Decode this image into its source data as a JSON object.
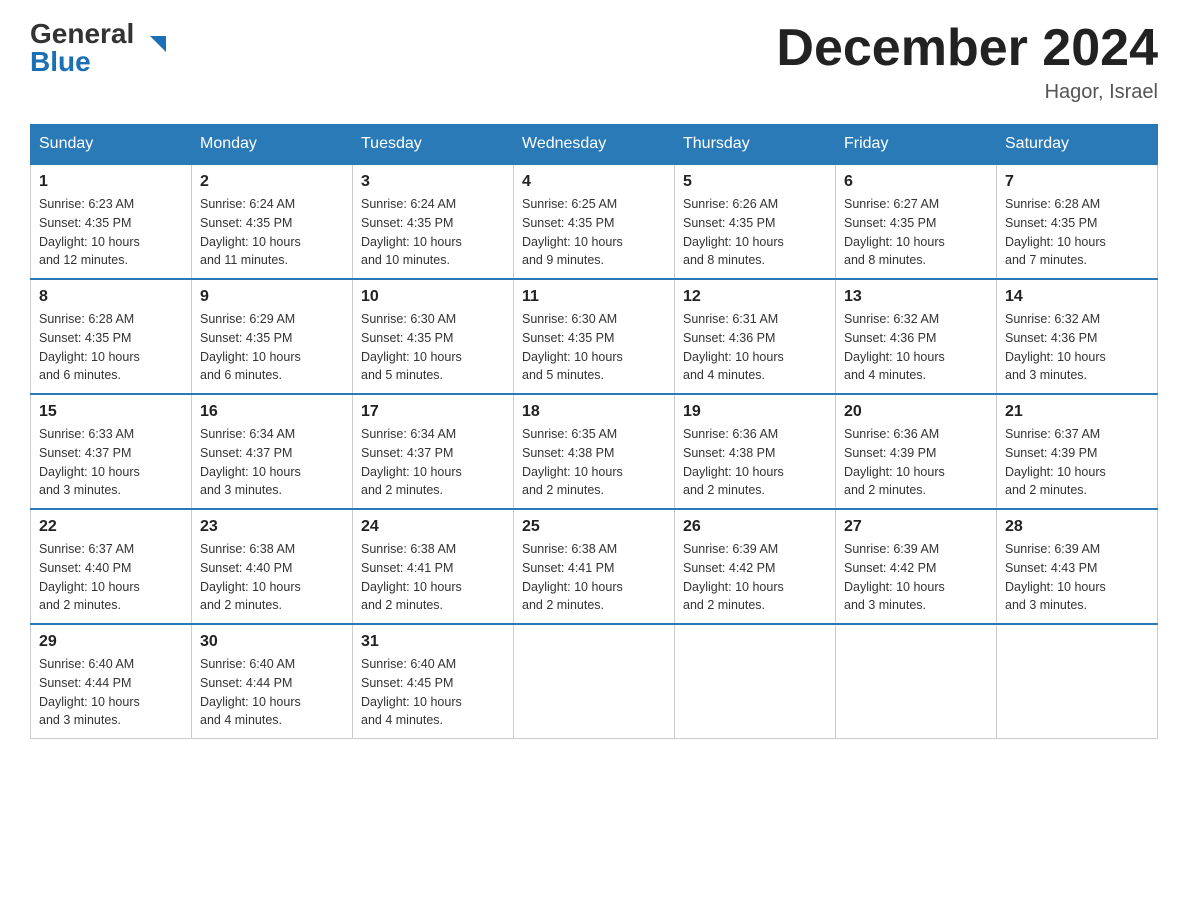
{
  "header": {
    "logo_general": "General",
    "logo_blue": "Blue",
    "month_title": "December 2024",
    "location": "Hagor, Israel"
  },
  "weekdays": [
    "Sunday",
    "Monday",
    "Tuesday",
    "Wednesday",
    "Thursday",
    "Friday",
    "Saturday"
  ],
  "weeks": [
    [
      {
        "day": "1",
        "sunrise": "6:23 AM",
        "sunset": "4:35 PM",
        "daylight": "10 hours and 12 minutes."
      },
      {
        "day": "2",
        "sunrise": "6:24 AM",
        "sunset": "4:35 PM",
        "daylight": "10 hours and 11 minutes."
      },
      {
        "day": "3",
        "sunrise": "6:24 AM",
        "sunset": "4:35 PM",
        "daylight": "10 hours and 10 minutes."
      },
      {
        "day": "4",
        "sunrise": "6:25 AM",
        "sunset": "4:35 PM",
        "daylight": "10 hours and 9 minutes."
      },
      {
        "day": "5",
        "sunrise": "6:26 AM",
        "sunset": "4:35 PM",
        "daylight": "10 hours and 8 minutes."
      },
      {
        "day": "6",
        "sunrise": "6:27 AM",
        "sunset": "4:35 PM",
        "daylight": "10 hours and 8 minutes."
      },
      {
        "day": "7",
        "sunrise": "6:28 AM",
        "sunset": "4:35 PM",
        "daylight": "10 hours and 7 minutes."
      }
    ],
    [
      {
        "day": "8",
        "sunrise": "6:28 AM",
        "sunset": "4:35 PM",
        "daylight": "10 hours and 6 minutes."
      },
      {
        "day": "9",
        "sunrise": "6:29 AM",
        "sunset": "4:35 PM",
        "daylight": "10 hours and 6 minutes."
      },
      {
        "day": "10",
        "sunrise": "6:30 AM",
        "sunset": "4:35 PM",
        "daylight": "10 hours and 5 minutes."
      },
      {
        "day": "11",
        "sunrise": "6:30 AM",
        "sunset": "4:35 PM",
        "daylight": "10 hours and 5 minutes."
      },
      {
        "day": "12",
        "sunrise": "6:31 AM",
        "sunset": "4:36 PM",
        "daylight": "10 hours and 4 minutes."
      },
      {
        "day": "13",
        "sunrise": "6:32 AM",
        "sunset": "4:36 PM",
        "daylight": "10 hours and 4 minutes."
      },
      {
        "day": "14",
        "sunrise": "6:32 AM",
        "sunset": "4:36 PM",
        "daylight": "10 hours and 3 minutes."
      }
    ],
    [
      {
        "day": "15",
        "sunrise": "6:33 AM",
        "sunset": "4:37 PM",
        "daylight": "10 hours and 3 minutes."
      },
      {
        "day": "16",
        "sunrise": "6:34 AM",
        "sunset": "4:37 PM",
        "daylight": "10 hours and 3 minutes."
      },
      {
        "day": "17",
        "sunrise": "6:34 AM",
        "sunset": "4:37 PM",
        "daylight": "10 hours and 2 minutes."
      },
      {
        "day": "18",
        "sunrise": "6:35 AM",
        "sunset": "4:38 PM",
        "daylight": "10 hours and 2 minutes."
      },
      {
        "day": "19",
        "sunrise": "6:36 AM",
        "sunset": "4:38 PM",
        "daylight": "10 hours and 2 minutes."
      },
      {
        "day": "20",
        "sunrise": "6:36 AM",
        "sunset": "4:39 PM",
        "daylight": "10 hours and 2 minutes."
      },
      {
        "day": "21",
        "sunrise": "6:37 AM",
        "sunset": "4:39 PM",
        "daylight": "10 hours and 2 minutes."
      }
    ],
    [
      {
        "day": "22",
        "sunrise": "6:37 AM",
        "sunset": "4:40 PM",
        "daylight": "10 hours and 2 minutes."
      },
      {
        "day": "23",
        "sunrise": "6:38 AM",
        "sunset": "4:40 PM",
        "daylight": "10 hours and 2 minutes."
      },
      {
        "day": "24",
        "sunrise": "6:38 AM",
        "sunset": "4:41 PM",
        "daylight": "10 hours and 2 minutes."
      },
      {
        "day": "25",
        "sunrise": "6:38 AM",
        "sunset": "4:41 PM",
        "daylight": "10 hours and 2 minutes."
      },
      {
        "day": "26",
        "sunrise": "6:39 AM",
        "sunset": "4:42 PM",
        "daylight": "10 hours and 2 minutes."
      },
      {
        "day": "27",
        "sunrise": "6:39 AM",
        "sunset": "4:42 PM",
        "daylight": "10 hours and 3 minutes."
      },
      {
        "day": "28",
        "sunrise": "6:39 AM",
        "sunset": "4:43 PM",
        "daylight": "10 hours and 3 minutes."
      }
    ],
    [
      {
        "day": "29",
        "sunrise": "6:40 AM",
        "sunset": "4:44 PM",
        "daylight": "10 hours and 3 minutes."
      },
      {
        "day": "30",
        "sunrise": "6:40 AM",
        "sunset": "4:44 PM",
        "daylight": "10 hours and 4 minutes."
      },
      {
        "day": "31",
        "sunrise": "6:40 AM",
        "sunset": "4:45 PM",
        "daylight": "10 hours and 4 minutes."
      },
      null,
      null,
      null,
      null
    ]
  ],
  "labels": {
    "sunrise": "Sunrise:",
    "sunset": "Sunset:",
    "daylight": "Daylight:"
  }
}
